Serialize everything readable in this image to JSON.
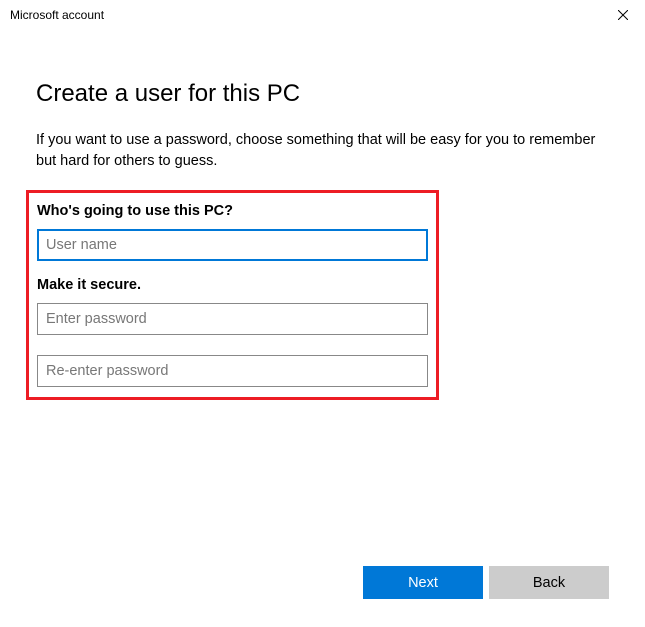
{
  "titlebar": {
    "title": "Microsoft account"
  },
  "page": {
    "heading": "Create a user for this PC",
    "subtitle": "If you want to use a password, choose something that will be easy for you to remember but hard for others to guess."
  },
  "form": {
    "section1_label": "Who's going to use this PC?",
    "username": {
      "value": "",
      "placeholder": "User name"
    },
    "section2_label": "Make it secure.",
    "password": {
      "value": "",
      "placeholder": "Enter password"
    },
    "password_confirm": {
      "value": "",
      "placeholder": "Re-enter password"
    }
  },
  "footer": {
    "next_label": "Next",
    "back_label": "Back"
  }
}
